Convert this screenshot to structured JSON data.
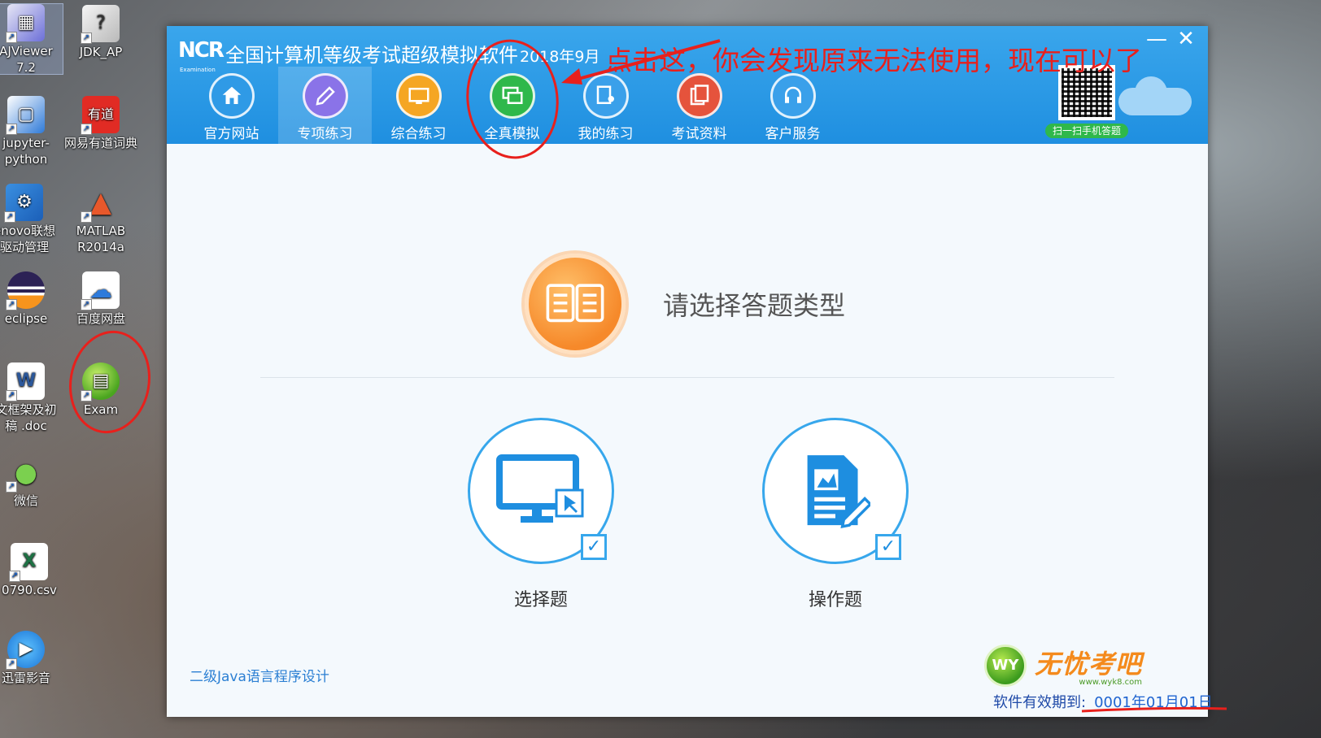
{
  "desktop_icons": [
    {
      "id": "ajviewer",
      "label_line1": "AJViewer",
      "label_line2": "7.2"
    },
    {
      "id": "jdk",
      "label_line1": "JDK_AP",
      "label_line2": ""
    },
    {
      "id": "jupyter",
      "label_line1": "jupyter-",
      "label_line2": "python"
    },
    {
      "id": "youdao",
      "label_line1": "网易有道词典",
      "label_line2": ""
    },
    {
      "id": "lenovo",
      "label_line1": "enovo联想",
      "label_line2": "驱动管理"
    },
    {
      "id": "matlab",
      "label_line1": "MATLAB",
      "label_line2": "R2014a"
    },
    {
      "id": "eclipse",
      "label_line1": "eclipse",
      "label_line2": ""
    },
    {
      "id": "baidu",
      "label_line1": "百度网盘",
      "label_line2": ""
    },
    {
      "id": "doc",
      "label_line1": "文框架及初",
      "label_line2": "稿 .doc"
    },
    {
      "id": "exam",
      "label_line1": "Exam",
      "label_line2": ""
    },
    {
      "id": "wechat",
      "label_line1": "微信",
      "label_line2": ""
    },
    {
      "id": "csv",
      "label_line1": "0790.csv",
      "label_line2": ""
    },
    {
      "id": "xunlei",
      "label_line1": "迅雷影音",
      "label_line2": ""
    }
  ],
  "app": {
    "logo_text": "NCR",
    "logo_sub": "Examination",
    "title": "全国计算机等级考试超级模拟软件",
    "version": "2018年9月",
    "minimize": "—",
    "close": "✕",
    "qr_label": "扫一扫手机答题",
    "nav": [
      {
        "label": "官方网站",
        "color": "#2f9ae6"
      },
      {
        "label": "专项练习",
        "color": "#8a73e8"
      },
      {
        "label": "综合练习",
        "color": "#f5a623"
      },
      {
        "label": "全真模拟",
        "color": "#2fb84b"
      },
      {
        "label": "我的练习",
        "color": "#3aa0ea"
      },
      {
        "label": "考试资料",
        "color": "#e5533c"
      },
      {
        "label": "客户服务",
        "color": "#3aa0ea"
      }
    ],
    "active_nav": 1,
    "choose_title": "请选择答题类型",
    "options": [
      {
        "label": "选择题"
      },
      {
        "label": "操作题"
      }
    ],
    "subject": "二级Java语言程序设计",
    "brand_name": "无忧考吧",
    "brand_url": "www.wyk8.com",
    "brand_badge": "WY",
    "expiry_label": "软件有效期到:",
    "expiry_date": "0001年01月01日"
  },
  "annotation": {
    "text": "点击这，你会发现原来无法使用，现在可以了",
    "color": "#e8201c"
  }
}
